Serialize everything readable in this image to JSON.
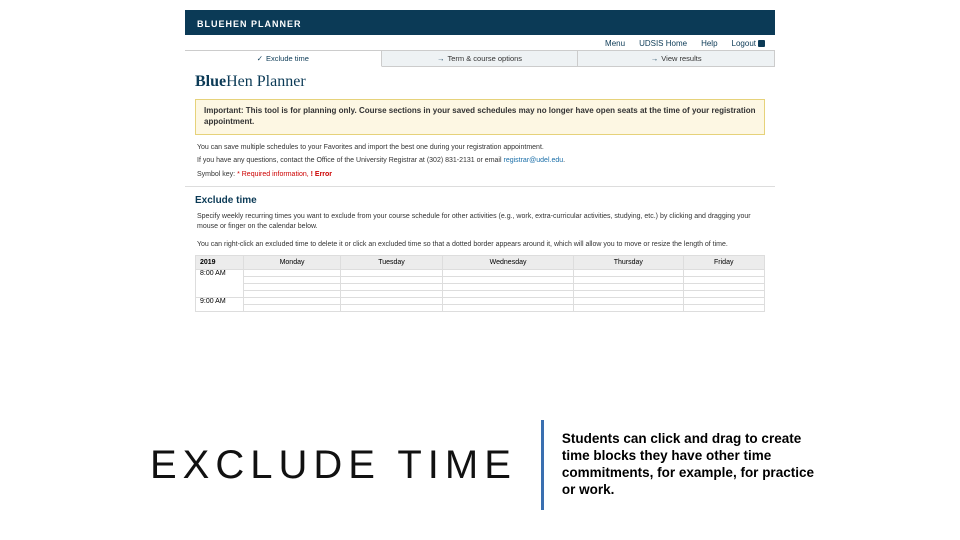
{
  "banner": {
    "title": "BLUEHEN PLANNER"
  },
  "topnav": {
    "menu": "Menu",
    "home": "UDSIS Home",
    "help": "Help",
    "logout": "Logout"
  },
  "tabs": {
    "t1": "Exclude time",
    "t2": "Term & course options",
    "t3": "View results"
  },
  "page": {
    "heading_a": "Blue",
    "heading_b": "Hen Planner",
    "notice_bold": "Important: This tool is for planning only. Course sections in your saved schedules may no longer have open seats at the time of your registration appointment.",
    "line1": "You can save multiple schedules to your Favorites and import the best one during your registration appointment.",
    "line2_pre": "If you have any questions, contact the Office of the University Registrar at (302) 831-2131 or email ",
    "line2_link": "registrar@udel.edu",
    "symkey_label": "Symbol key: ",
    "symkey_req": "* Required information, ",
    "symkey_err": "! Error",
    "section_title": "Exclude time",
    "section_p1": "Specify weekly recurring times you want to exclude from your course schedule for other activities (e.g., work, extra-curricular activities, studying, etc.) by clicking and dragging your mouse or finger on the calendar below.",
    "section_p2": "You can right-click an excluded time to delete it or click an excluded time so that a dotted border appears around it, which will allow you to move or resize the length of time."
  },
  "calendar": {
    "year": "2019",
    "days": [
      "Monday",
      "Tuesday",
      "Wednesday",
      "Thursday",
      "Friday"
    ],
    "times": [
      "8:00 AM",
      "9:00 AM"
    ]
  },
  "slide_caption": {
    "title": "EXCLUDE TIME",
    "body": "Students can click and drag to create time blocks they have other time commitments, for example, for practice or work."
  }
}
